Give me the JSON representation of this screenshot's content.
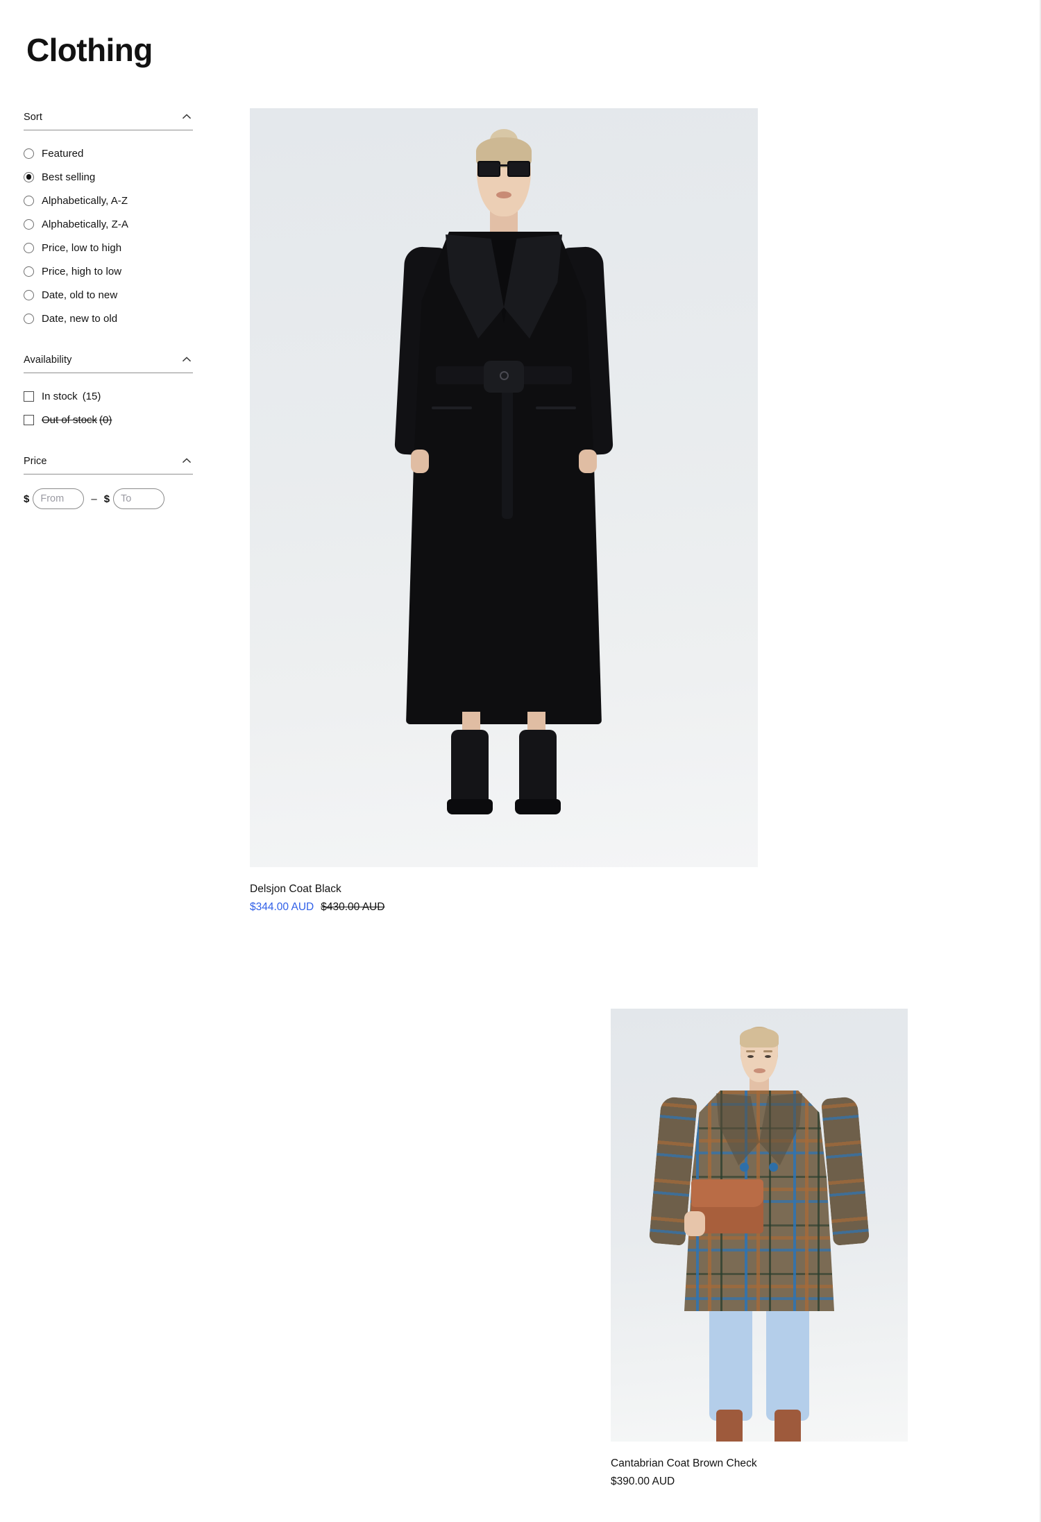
{
  "page": {
    "title": "Clothing"
  },
  "facets": {
    "sort": {
      "title": "Sort",
      "toggle_icon": "chevron-up-icon",
      "selected": "Best selling",
      "options": [
        {
          "label": "Featured",
          "selected": false
        },
        {
          "label": "Best selling",
          "selected": true
        },
        {
          "label": "Alphabetically, A-Z",
          "selected": false
        },
        {
          "label": "Alphabetically, Z-A",
          "selected": false
        },
        {
          "label": "Price, low to high",
          "selected": false
        },
        {
          "label": "Price, high to low",
          "selected": false
        },
        {
          "label": "Date, old to new",
          "selected": false
        },
        {
          "label": "Date, new to old",
          "selected": false
        }
      ]
    },
    "availability": {
      "title": "Availability",
      "toggle_icon": "chevron-up-icon",
      "options": [
        {
          "label": "In stock",
          "count": "(15)",
          "checked": false,
          "disabled": false
        },
        {
          "label": "Out of stock",
          "count": "(0)",
          "checked": false,
          "disabled": true
        }
      ]
    },
    "price": {
      "title": "Price",
      "toggle_icon": "chevron-up-icon",
      "currency_symbol": "$",
      "separator": "–",
      "from": {
        "value": "",
        "placeholder": "From"
      },
      "to": {
        "value": "",
        "placeholder": "To"
      }
    }
  },
  "products": [
    {
      "title": "Delsjon Coat Black",
      "price": "$344.00 AUD",
      "compare_at_price": "$430.00 AUD",
      "on_sale": true
    },
    {
      "title": "Cantabrian Coat Brown Check",
      "price": "$390.00 AUD",
      "compare_at_price": "",
      "on_sale": false
    }
  ],
  "colors": {
    "sale_price": "#2f5fe8",
    "text": "#121212",
    "rule": "#8f8f8f"
  }
}
